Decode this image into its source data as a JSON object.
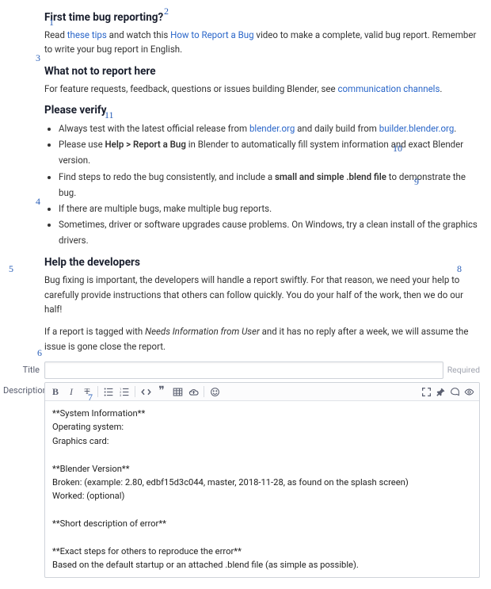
{
  "section1": {
    "heading": "First time bug reporting?",
    "p1a": "Read ",
    "link1": "these tips",
    "p1b": " and watch this ",
    "link2": "How to Report a Bug",
    "p1c": " video to make a complete, valid bug report. Remember to write your bug report in English."
  },
  "section2": {
    "heading": "What not to report here",
    "p1a": "For feature requests, feedback, questions or issues building Blender, see ",
    "link1": "communication channels",
    "p1b": "."
  },
  "verify": {
    "heading": "Please verify",
    "li1a": "Always test with the latest official release from ",
    "li1link1": "blender.org",
    "li1b": " and daily build from ",
    "li1link2": "builder.blender.org",
    "li1c": ".",
    "li2a": "Please use ",
    "li2b": "Help > Report a Bug",
    "li2c": " in Blender to automatically fill system information and exact Blender version.",
    "li3a": "Find steps to redo the bug consistently, and include a ",
    "li3b": "small and simple .blend file",
    "li3c": " to demonstrate the bug.",
    "li4": "If there are multiple bugs, make multiple bug reports.",
    "li5": "Sometimes, driver or software upgrades cause problems. On Windows, try a clean install of the graphics drivers."
  },
  "help": {
    "heading": "Help the developers",
    "p1": "Bug fixing is important, the developers will handle a report swiftly. For that reason, we need your help to carefully provide instructions that others can follow quickly. You do your half of the work, then we do our half!",
    "p2a": "If a report is tagged with ",
    "p2em": "Needs Information from User",
    "p2b": " and it has no reply after a week, we will assume the issue is gone close the report."
  },
  "form": {
    "title_label": "Title",
    "title_value": "",
    "required": "Required",
    "desc_label": "Description",
    "desc_value": "**System Information**\nOperating system:\nGraphics card:\n\n**Blender Version**\nBroken: (example: 2.80, edbf15d3c044, master, 2018-11-28, as found on the splash screen)\nWorked: (optional)\n\n**Short description of error**\n\n**Exact steps for others to reproduce the error**\nBased on the default startup or an attached .blend file (as simple as possible)."
  },
  "annotations": {
    "n1": "1",
    "n2": "2",
    "n3": "3",
    "n4": "4",
    "n5": "5",
    "n6": "6",
    "n7": "7",
    "n8": "8",
    "n9": "9",
    "n10": "10",
    "n11": "11"
  }
}
